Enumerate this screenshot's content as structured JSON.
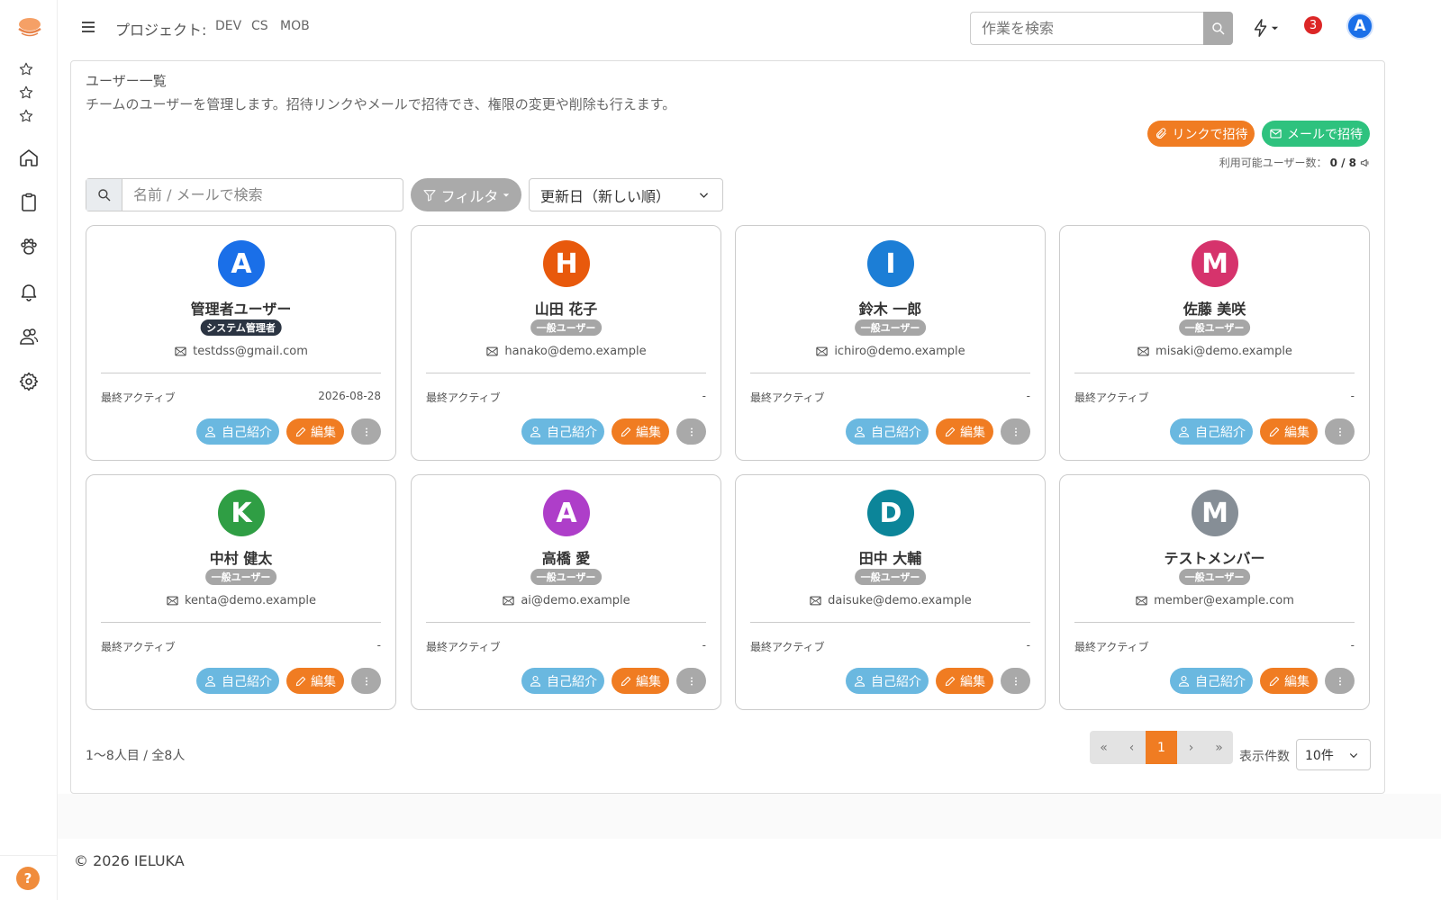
{
  "header": {
    "menu_icon": "hamburger-icon",
    "project_label": "プロジェクト:",
    "projects": [
      "DEV",
      "CS",
      "MOB"
    ],
    "search_placeholder": "作業を検索",
    "notification_count": "3",
    "user_initial": "A"
  },
  "sidebar": {
    "items": [
      {
        "icon": "star-icon"
      },
      {
        "icon": "star-icon"
      },
      {
        "icon": "star-icon"
      },
      {
        "icon": "home-icon"
      },
      {
        "icon": "clipboard-icon"
      },
      {
        "icon": "paw-icon"
      },
      {
        "icon": "bell-icon"
      },
      {
        "icon": "users-icon"
      },
      {
        "icon": "gear-icon"
      }
    ],
    "help_label": "?"
  },
  "page": {
    "title": "ユーザー一覧",
    "description": "チームのユーザーを管理します。招待リンクやメールで招待でき、権限の変更や削除も行えます。",
    "invite_link_label": "リンクで招待",
    "invite_mail_label": "メールで招待",
    "available_label": "利用可能ユーザー数：",
    "available_value": "0 / 8",
    "search_placeholder": "名前 / メールで検索",
    "filter_label": "フィルタ",
    "sort_value": "更新日（新しい順）"
  },
  "users": [
    {
      "initial": "A",
      "name": "管理者ユーザー",
      "role": "システム管理者",
      "email": "testdss@gmail.com",
      "last_active": "2026-08-28",
      "color": "#1a6fe8",
      "role_color": "#2b3442"
    },
    {
      "initial": "H",
      "name": "山田 花子",
      "role": "一般ユーザー",
      "email": "hanako@demo.example",
      "last_active": "-",
      "color": "#e8590c",
      "role_color": "#a6a6a6"
    },
    {
      "initial": "I",
      "name": "鈴木 一郎",
      "role": "一般ユーザー",
      "email": "ichiro@demo.example",
      "last_active": "-",
      "color": "#1c7ed6",
      "role_color": "#a6a6a6"
    },
    {
      "initial": "M",
      "name": "佐藤 美咲",
      "role": "一般ユーザー",
      "email": "misaki@demo.example",
      "last_active": "-",
      "color": "#d6336c",
      "role_color": "#a6a6a6"
    },
    {
      "initial": "K",
      "name": "中村 健太",
      "role": "一般ユーザー",
      "email": "kenta@demo.example",
      "last_active": "-",
      "color": "#2f9e44",
      "role_color": "#a6a6a6"
    },
    {
      "initial": "A",
      "name": "高橋 愛",
      "role": "一般ユーザー",
      "email": "ai@demo.example",
      "last_active": "-",
      "color": "#ae3ec9",
      "role_color": "#a6a6a6"
    },
    {
      "initial": "D",
      "name": "田中 大輔",
      "role": "一般ユーザー",
      "email": "daisuke@demo.example",
      "last_active": "-",
      "color": "#0c8599",
      "role_color": "#a6a6a6"
    },
    {
      "initial": "M",
      "name": "テストメンバー",
      "role": "一般ユーザー",
      "email": "member@example.com",
      "last_active": "-",
      "color": "#868e96",
      "role_color": "#a6a6a6"
    }
  ],
  "card_labels": {
    "last_active_label": "最終アクティブ",
    "intro_label": "自己紹介",
    "edit_label": "編集"
  },
  "pagination": {
    "range_info": "1〜8人目 / 全8人",
    "first": "«",
    "prev": "‹",
    "current": "1",
    "next": "›",
    "last": "»",
    "per_page_label": "表示件数",
    "per_page_value": "10件"
  },
  "footer": {
    "copyright": "© 2026 IELUKA"
  }
}
